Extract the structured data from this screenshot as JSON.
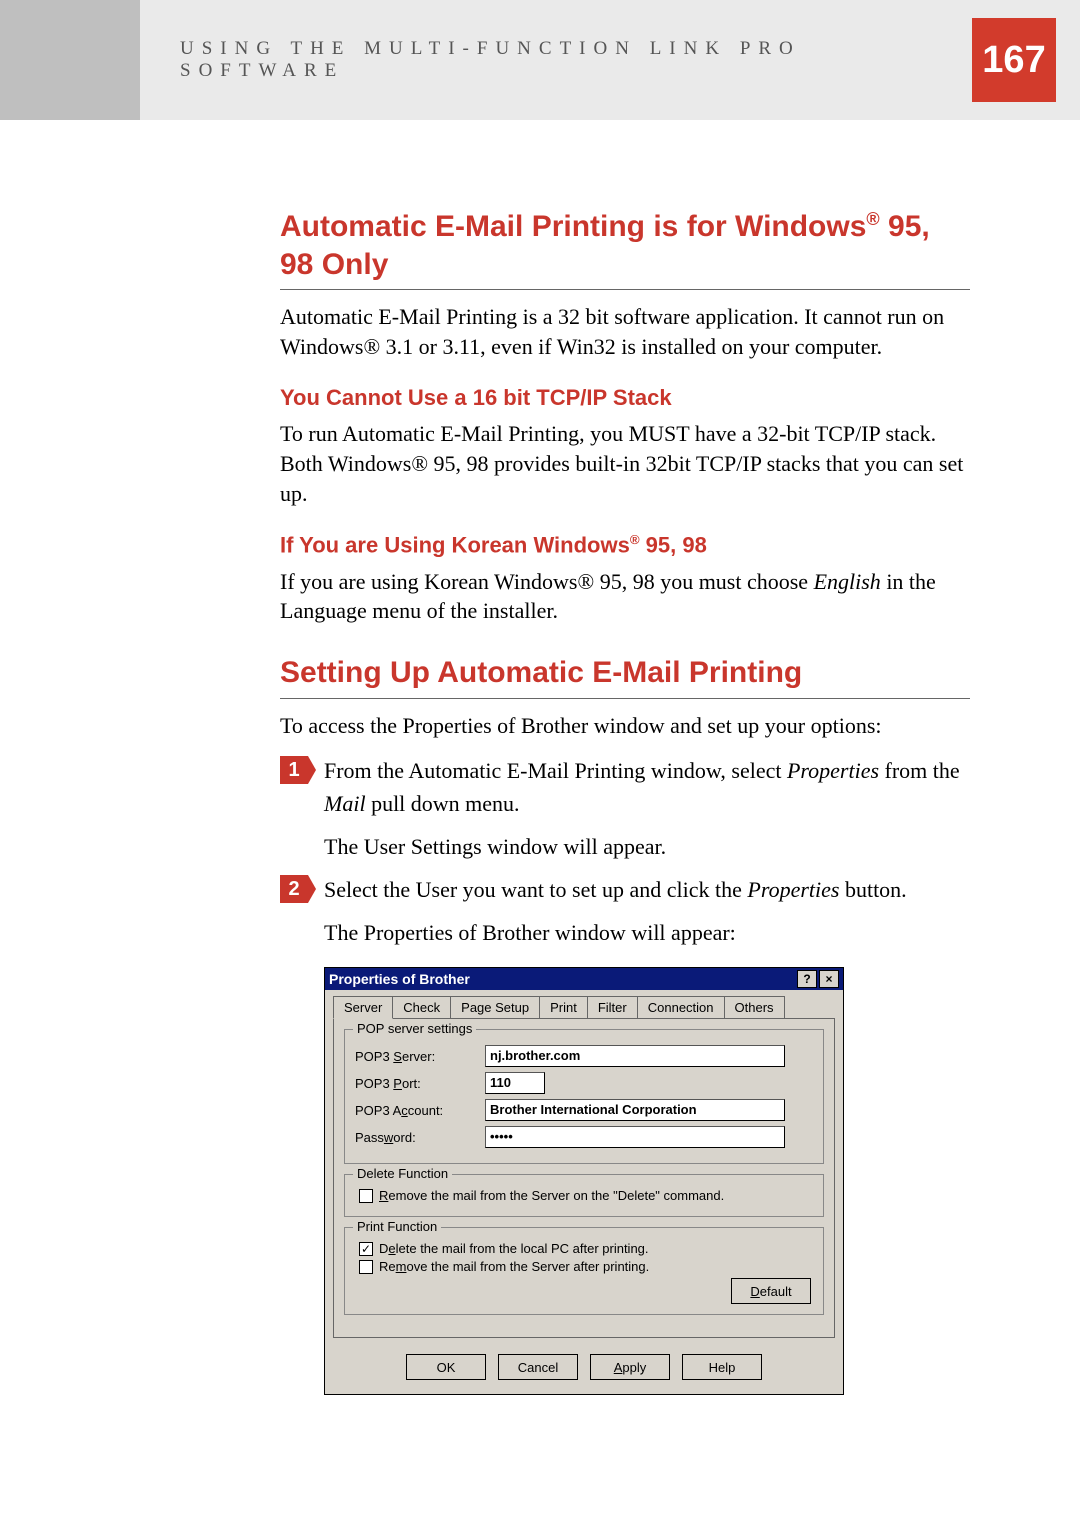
{
  "header": {
    "chapter_label": "USING THE MULTI-FUNCTION LINK PRO SOFTWARE",
    "page_number": "167"
  },
  "sections": {
    "auto_email_title_pre": "Automatic E-Mail Printing is for Windows",
    "auto_email_title_post": " 95, 98 Only",
    "auto_email_body": "Automatic E-Mail Printing is a 32 bit software application. It cannot run on Windows® 3.1 or 3.11, even if Win32 is installed on your computer.",
    "tcpip_title": "You Cannot Use a 16 bit TCP/IP Stack",
    "tcpip_body": "To run Automatic E-Mail Printing, you MUST have a 32-bit TCP/IP stack. Both Windows®  95, 98 provides built-in 32bit TCP/IP stacks that you can set up.",
    "korean_title_pre": "If You are Using Korean Windows",
    "korean_title_post": " 95, 98",
    "korean_body_a": "If you are using Korean Windows® 95, 98 you must choose ",
    "korean_body_em": "English",
    "korean_body_b": " in the Language menu of the installer.",
    "setup_title": "Setting Up Automatic E-Mail Printing",
    "setup_intro": "To access the Properties of Brother window and set up your options:",
    "steps": {
      "s1_num": "1",
      "s1_a": "From the Automatic E-Mail Printing window, select ",
      "s1_em": "Properties",
      "s1_b": " from the ",
      "s1_em2": "Mail",
      "s1_c": " pull down menu.",
      "s1_follow": "The User Settings window will appear.",
      "s2_num": "2",
      "s2_a": "Select the User you want to set up and click the ",
      "s2_em": "Properties",
      "s2_b": " button.",
      "s2_follow": "The Properties of Brother window will appear:"
    }
  },
  "dialog": {
    "title": "Properties of Brother",
    "help_btn": "?",
    "close_btn": "×",
    "tabs": [
      "Server",
      "Check",
      "Page Setup",
      "Print",
      "Filter",
      "Connection",
      "Others"
    ],
    "group_pop_title": "POP server settings",
    "labels": {
      "server_pre": "POP3 ",
      "server_ul": "S",
      "server_post": "erver:",
      "port_pre": "POP3 ",
      "port_ul": "P",
      "port_post": "ort:",
      "account_pre": "POP3 A",
      "account_ul": "c",
      "account_post": "count:",
      "password_pre": "Pass",
      "password_ul": "w",
      "password_post": "ord:"
    },
    "values": {
      "server": "nj.brother.com",
      "port": "110",
      "account": "Brother International Corporation",
      "password": "•••••"
    },
    "group_delete_title": "Delete Function",
    "delete_checkbox_ul": "R",
    "delete_checkbox_post": "emove the mail from the Server on the \"Delete\" command.",
    "group_print_title": "Print Function",
    "print_cb1_pre": "D",
    "print_cb1_ul": "e",
    "print_cb1_post": "lete the mail from the local PC after printing.",
    "print_cb2_pre": "Re",
    "print_cb2_ul": "m",
    "print_cb2_post": "ove the mail from the Server after printing.",
    "default_btn_ul": "D",
    "default_btn_post": "efault",
    "buttons": {
      "ok": "OK",
      "cancel": "Cancel",
      "apply_ul": "A",
      "apply_post": "pply",
      "help": "Help"
    }
  }
}
